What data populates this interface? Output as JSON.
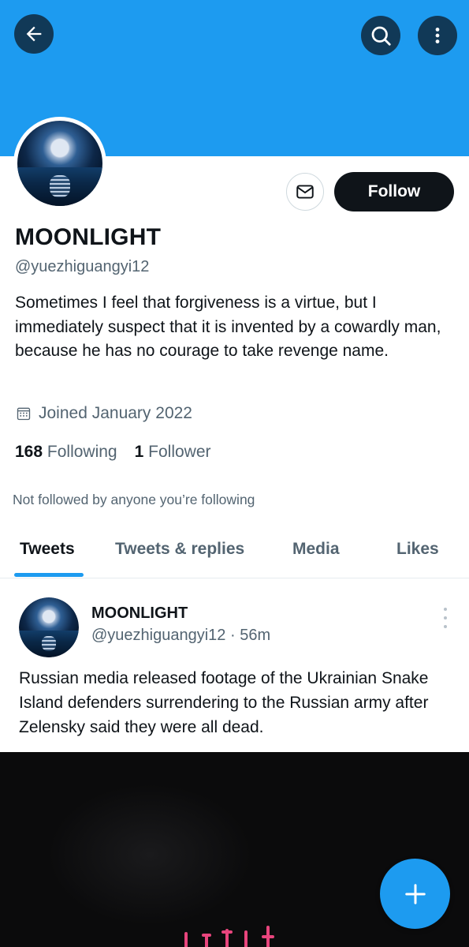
{
  "profile": {
    "display_name": "MOONLIGHT",
    "handle": "@yuezhiguangyi12",
    "bio": "Sometimes I feel that forgiveness is a virtue, but I immediately suspect that it is invented by a cowardly man, because he has no courage to take revenge name.",
    "joined": "Joined January 2022",
    "following_count": "168",
    "following_label": "Following",
    "followers_count": "1",
    "followers_label": "Follower",
    "not_followed_text": "Not followed by anyone you’re following",
    "follow_label": "Follow"
  },
  "header": {
    "back_icon": "arrow-left-icon",
    "search_icon": "search-icon",
    "more_icon": "more-vertical-icon",
    "banner_color": "#1d9bf0"
  },
  "tabs": [
    {
      "label": "Tweets",
      "active": true
    },
    {
      "label": "Tweets & replies",
      "active": false
    },
    {
      "label": "Media",
      "active": false
    },
    {
      "label": "Likes",
      "active": false
    }
  ],
  "tweet": {
    "name": "MOONLIGHT",
    "handle_time": "@yuezhiguangyi12 · 56m",
    "text": "Russian media released footage of the Ukrainian Snake Island defenders surrendering to the Russian army after Zelensky said they were all dead."
  },
  "colors": {
    "accent": "#1d9bf0",
    "text_primary": "#0f1419",
    "text_secondary": "#536471"
  }
}
